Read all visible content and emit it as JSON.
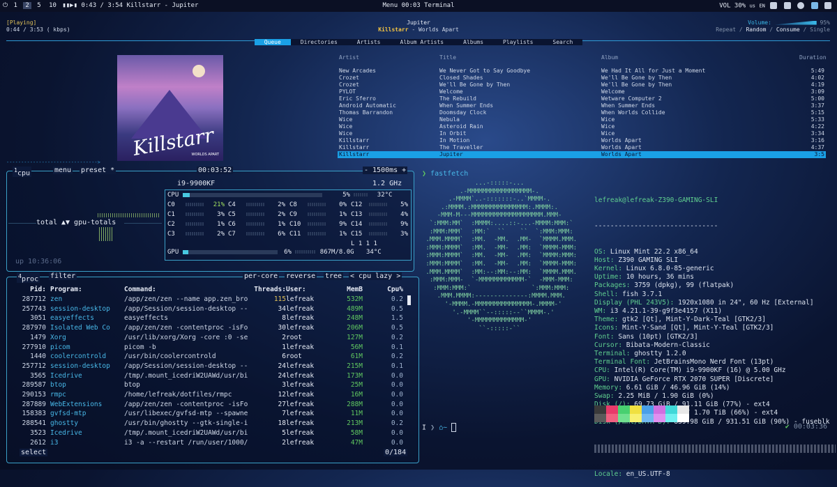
{
  "topbar": {
    "workspaces": [
      "1",
      "2",
      "5",
      "10"
    ],
    "active_workspace": "2",
    "player_prefix": "▮▮▶▮",
    "player_time": "0:43 / 3:54",
    "player_track": "Killstarr - Jupiter",
    "center": "Menu  00:03  Terminal",
    "volume": "VOL 30%",
    "lang": "us",
    "lang2": "EN"
  },
  "rmpc": {
    "status": "[Playing]",
    "elapsed": "0:44 / 3:53 ( kbps)",
    "title": "Jupiter",
    "artist": "Killstarr",
    "album_suffix": " - Worlds Apart",
    "volume_label": "Volume:",
    "volume_value": "95%",
    "volume_fraction": 0.95,
    "modes": [
      "Repeat",
      "Random",
      "Consume",
      "Single"
    ],
    "modes_active": [
      "Random",
      "Consume"
    ],
    "tabs": [
      "Queue",
      "Directories",
      "Artists",
      "Album Artists",
      "Albums",
      "Playlists",
      "Search"
    ],
    "active_tab": "Queue",
    "cover": {
      "logo": "Killstarr",
      "subtitle": "WORLDS APART"
    },
    "queue_headers": [
      "Artist",
      "Title",
      "Album",
      "Duration"
    ],
    "queue": [
      [
        "New Arcades",
        "We Never Got to Say Goodbye",
        "We Had It All for Just a Moment",
        "5:49"
      ],
      [
        "Crozet",
        "Closed Shades",
        "We'll Be Gone by Then",
        "4:02"
      ],
      [
        "Crozet",
        "We'll Be Gone by Then",
        "We'll Be Gone by Then",
        "4:19"
      ],
      [
        "PYLOT",
        "Welcome",
        "Welcome",
        "3:09"
      ],
      [
        "Eric Sferro",
        "The Rebuild",
        "Wetware Computer 2",
        "5:00"
      ],
      [
        "Android Automatic",
        "When Summer Ends",
        "When Summer Ends",
        "3:37"
      ],
      [
        "Thomas Barrandon",
        "Doomsday Clock",
        "When Worlds Collide",
        "5:15"
      ],
      [
        "Wice",
        "Nebula",
        "Wice",
        "5:33"
      ],
      [
        "Wice",
        "Asteroid Rain",
        "Wice",
        "4:22"
      ],
      [
        "Wice",
        "In Orbit",
        "Wice",
        "3:34"
      ],
      [
        "Killstarr",
        "In Motion",
        "Worlds Apart",
        "3:16"
      ],
      [
        "Killstarr",
        "The Traveller",
        "Worlds Apart",
        "4:37"
      ],
      [
        "Killstarr",
        "Jupiter",
        "Worlds Apart",
        "3:5"
      ]
    ],
    "selected_index": 12,
    "progress_text": "------------------------------->"
  },
  "btop_cpu": {
    "tab_num": "1",
    "tab_cpu": "cpu",
    "menu": "menu",
    "preset": "preset *",
    "clock": "00:03:52",
    "interval": "- 1500ms +",
    "model": "i9-9900KF",
    "freq": "1.2 GHz",
    "total_label": "total",
    "gpu_total_label": "▲▼ gpu-totals",
    "uptime": "up 10:36:06",
    "cpu_label": "CPU",
    "cpu_total": "5%",
    "cpu_temp": "32°C",
    "cores": [
      [
        "C0",
        "21%"
      ],
      [
        "C1",
        "3%"
      ],
      [
        "C2",
        "1%"
      ],
      [
        "C3",
        "2%"
      ],
      [
        "C4",
        "2%"
      ],
      [
        "C5",
        "2%"
      ],
      [
        "C6",
        "1%"
      ],
      [
        "C7",
        "6%"
      ],
      [
        "C8",
        "0%"
      ],
      [
        "C9",
        "1%"
      ],
      [
        "C10",
        "9%"
      ],
      [
        "C11",
        "1%"
      ],
      [
        "C12",
        "5%"
      ],
      [
        "C13",
        "4%"
      ],
      [
        "C14",
        "9%"
      ],
      [
        "C15",
        "3%"
      ]
    ],
    "load": "L 1 1 1",
    "gpu_label": "GPU",
    "gpu_pct": "6%",
    "gpu_mem": "867M/8.0G",
    "gpu_temp": "34°C"
  },
  "btop_proc": {
    "tab_num": "4",
    "tab_proc": "proc",
    "filter": "filter",
    "per_core": "per-core",
    "reverse": "reverse",
    "tree": "tree",
    "sort": "< cpu lazy >",
    "headers": [
      "Pid:",
      "Program:",
      "Command:",
      "Threads:",
      "User:",
      "MemB",
      "Cpu%"
    ],
    "rows": [
      [
        "287712",
        "zen",
        "/app/zen/zen --name app.zen_bro",
        "115",
        "lefreak",
        "532M",
        "0.2"
      ],
      [
        "257743",
        "session-desktop",
        "/app/Session/session-desktop --",
        "34",
        "lefreak",
        "489M",
        "0.5"
      ],
      [
        "3051",
        "easyeffects",
        "easyeffects",
        "8",
        "lefreak",
        "248M",
        "1.5"
      ],
      [
        "287970",
        "Isolated Web Co",
        "/app/zen/zen -contentproc -isFo",
        "30",
        "lefreak",
        "206M",
        "0.5"
      ],
      [
        "1479",
        "Xorg",
        "/usr/lib/xorg/Xorg -core :0 -se",
        "2",
        "root",
        "127M",
        "0.2"
      ],
      [
        "277910",
        "picom",
        "picom -b",
        "1",
        "lefreak",
        "56M",
        "0.1"
      ],
      [
        "1440",
        "coolercontrold",
        "/usr/bin/coolercontrold",
        "6",
        "root",
        "61M",
        "0.2"
      ],
      [
        "257712",
        "session-desktop",
        "/app/Session/session-desktop --",
        "24",
        "lefreak",
        "215M",
        "0.1"
      ],
      [
        "3565",
        "Icedrive",
        "/tmp/.mount_icedriW2UAWd/usr/bi",
        "24",
        "lefreak",
        "173M",
        "0.0"
      ],
      [
        "289587",
        "btop",
        "btop",
        "3",
        "lefreak",
        "25M",
        "0.0"
      ],
      [
        "290153",
        "rmpc",
        "/home/lefreak/dotfiles/rmpc",
        "12",
        "lefreak",
        "16M",
        "0.0"
      ],
      [
        "287889",
        "WebExtensions",
        "/app/zen/zen -contentproc -isFo",
        "27",
        "lefreak",
        "288M",
        "0.0"
      ],
      [
        "158383",
        "gvfsd-mtp",
        "/usr/libexec/gvfsd-mtp --spawne",
        "7",
        "lefreak",
        "11M",
        "0.0"
      ],
      [
        "288541",
        "ghostty",
        "/usr/bin/ghostty --gtk-single-i",
        "18",
        "lefreak",
        "213M",
        "0.2"
      ],
      [
        "3523",
        "Icedrive",
        "/tmp/.mount_icedriW2UAWd/usr/bi",
        "5",
        "lefreak",
        "58M",
        "0.0"
      ],
      [
        "2612",
        "i3",
        "i3 -a --restart /run/user/1000/",
        "2",
        "lefreak",
        "47M",
        "0.0"
      ]
    ],
    "select_label": "select",
    "count": "0/184"
  },
  "fastfetch": {
    "prompt_cmd": "fastfetch",
    "ascii": [
      "              ...-:::::-...",
      "          .-MMMMMMMMMMMMMMMMM-.",
      "       .-MMMM`..-:::::::-..`MMMM-.",
      "     .:MMMM.:MMMMMMMMMMMMMMM:.MMMM:.",
      "    -MMM-M---MMMMMMMMMMMMMMMMMMM.MMM-",
      "  `:MMM:MM`  :MMMM:....::-...-MMMM:MMM:`",
      "  :MMM:MMM`  :MM:`  ``    ``  `:MMM:MMM:",
      " .MMM.MMMM`  :MM.  -MM.  .MM-  `MMMM.MMM.",
      " :MMM:MMMM`  :MM.  -MM-  .MM:  `MMMM-MMM:",
      " :MMM:MMMM`  :MM.  -MM-  .MM:  `MMMM:MMM:",
      " :MMM:MMMM`  :MM.  -MM-  .MM:  `MMMM-MMM:",
      " .MMM.MMMM`  :MM:--:MM:--:MM:  `MMMM.MMM.",
      "  :MMM:MMM-  `-MMMMMMMMMMMM-`  -MMM-MMM:",
      "   :MMM:MMM:`                `:MMM:MMM:",
      "    .MMM.MMMM:--------------:MMMM.MMM.",
      "      '-MMMM.-MMMMMMMMMMMMMMM-.MMMM-'",
      "        '.-MMMM``--:::::--``MMMM-.'",
      "            '-MMMMMMMMMMMMM-'",
      "               ``-:::::-``"
    ],
    "user_host": "lefreak@lefreak-Z390-GAMING-SLI",
    "separator": "-------------------------------",
    "info": [
      [
        "OS:",
        "Linux Mint 22.2 x86_64"
      ],
      [
        "Host:",
        "Z390 GAMING SLI"
      ],
      [
        "Kernel:",
        "Linux 6.8.0-85-generic"
      ],
      [
        "Uptime:",
        "10 hours, 36 mins"
      ],
      [
        "Packages:",
        "3759 (dpkg), 99 (flatpak)"
      ],
      [
        "Shell:",
        "fish 3.7.1"
      ],
      [
        "Display (PHL 243V5):",
        "1920x1080 in 24\", 60 Hz [External]"
      ],
      [
        "WM:",
        "i3 4.21.1-39-g9f3e4157 (X11)"
      ],
      [
        "Theme:",
        "gtk2 [Qt], Mint-Y-Dark-Teal [GTK2/3]"
      ],
      [
        "Icons:",
        "Mint-Y-Sand [Qt], Mint-Y-Teal [GTK2/3]"
      ],
      [
        "Font:",
        "Sans (10pt) [GTK2/3]"
      ],
      [
        "Cursor:",
        "Bibata-Modern-Classic"
      ],
      [
        "Terminal:",
        "ghostty 1.2.0"
      ],
      [
        "Terminal Font:",
        "JetBrainsMono Nerd Font (13pt)"
      ],
      [
        "CPU:",
        "Intel(R) Core(TM) i9-9900KF (16) @ 5.00 GHz"
      ],
      [
        "GPU:",
        "NVIDIA GeForce RTX 2070 SUPER [Discrete]"
      ],
      [
        "Memory:",
        "6.61 GiB / 46.96 GiB (14%)"
      ],
      [
        "Swap:",
        "2.25 MiB / 1.90 GiB (0%)"
      ],
      [
        "Disk (/):",
        "69.73 GiB / 91.11 GiB (77%) - ext4"
      ],
      [
        "Disk (/home):",
        "1.12 TiB / 1.70 TiB (66%) - ext4"
      ],
      [
        "Disk (/mnt/DATA-D):",
        "839.98 GiB / 931.51 GiB (90%) - fuseblk"
      ]
    ],
    "locale_label": "Locale:",
    "locale": "en_US.UTF-8",
    "swatches_top": [
      "#3a3a3a",
      "#e83a6a",
      "#48d070",
      "#f0e040",
      "#4aa0e8",
      "#d070e0",
      "#40d8d8",
      "#e8e8e8"
    ],
    "swatches_bottom": [
      "#5a5a5a",
      "#f06080",
      "#70e090",
      "#f8f070",
      "#70b8f0",
      "#e090f0",
      "#70f0f0",
      "#ffffff"
    ],
    "prompt_left": "I",
    "prompt_time": "00:03:36"
  }
}
